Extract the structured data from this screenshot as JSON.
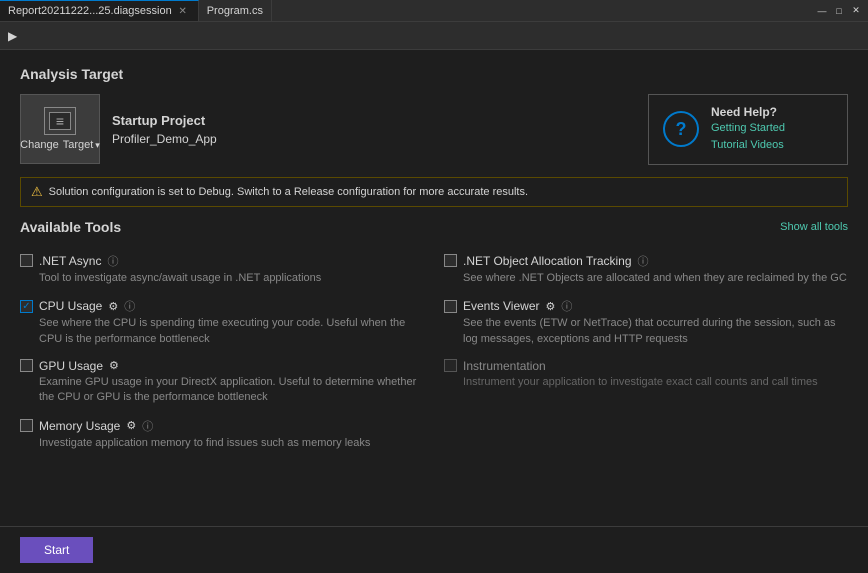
{
  "tabs": [
    {
      "label": "Report20211222...25.diagsession",
      "active": true,
      "closable": true
    },
    {
      "label": "Program.cs",
      "active": false,
      "closable": false
    }
  ],
  "titlebar": {
    "controls": [
      "—",
      "□",
      "✕"
    ]
  },
  "analysis": {
    "section_title": "Analysis Target",
    "change_target_label": "Change",
    "target_label": "Target",
    "project_label": "Startup Project",
    "project_name": "Profiler_Demo_App"
  },
  "need_help": {
    "title": "Need Help?",
    "link1": "Getting Started",
    "link2": "Tutorial Videos"
  },
  "warning": {
    "text": "Solution configuration is set to Debug. Switch to a Release configuration for more accurate results."
  },
  "tools": {
    "section_title": "Available Tools",
    "show_all": "Show all tools",
    "items": [
      {
        "id": "dotnet-async",
        "name": ".NET Async",
        "checked": false,
        "disabled": false,
        "has_info": true,
        "has_gear": false,
        "description": "Tool to investigate async/await usage in .NET applications"
      },
      {
        "id": "dotnet-object-allocation",
        "name": ".NET Object Allocation Tracking",
        "checked": false,
        "disabled": false,
        "has_info": true,
        "has_gear": false,
        "description": "See where .NET Objects are allocated and when they are reclaimed by the GC"
      },
      {
        "id": "cpu-usage",
        "name": "CPU Usage",
        "checked": true,
        "disabled": false,
        "has_info": true,
        "has_gear": true,
        "description": "See where the CPU is spending time executing your code. Useful when the CPU is the performance bottleneck"
      },
      {
        "id": "events-viewer",
        "name": "Events Viewer",
        "checked": false,
        "disabled": false,
        "has_info": true,
        "has_gear": true,
        "description": "See the events (ETW or NetTrace) that occurred during the session, such as log messages, exceptions and HTTP requests"
      },
      {
        "id": "gpu-usage",
        "name": "GPU Usage",
        "checked": false,
        "disabled": false,
        "has_info": false,
        "has_gear": true,
        "description": "Examine GPU usage in your DirectX application. Useful to determine whether the CPU or GPU is the performance bottleneck"
      },
      {
        "id": "instrumentation",
        "name": "Instrumentation",
        "checked": false,
        "disabled": true,
        "has_info": false,
        "has_gear": false,
        "description": "Instrument your application to investigate exact call counts and call times"
      },
      {
        "id": "memory-usage",
        "name": "Memory Usage",
        "checked": false,
        "disabled": false,
        "has_info": true,
        "has_gear": true,
        "description": "Investigate application memory to find issues such as memory leaks"
      }
    ]
  },
  "start_button": "Start",
  "colors": {
    "accent": "#007acc",
    "link": "#4ec9b0",
    "warning": "#f0c040",
    "purple": "#6a4fbd"
  }
}
